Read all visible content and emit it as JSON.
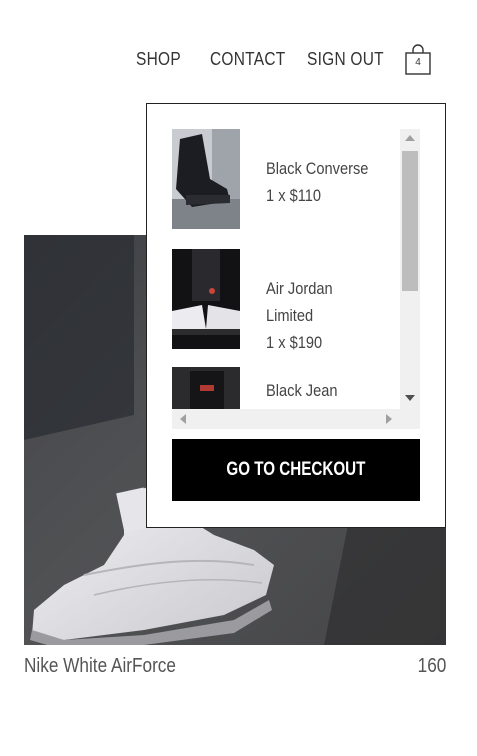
{
  "nav": {
    "items": [
      {
        "label": "SHOP"
      },
      {
        "label": "CONTACT"
      },
      {
        "label": "SIGN OUT"
      }
    ],
    "cart_icon": "shopping-bag-icon",
    "cart_count": "4"
  },
  "product": {
    "name": "Nike White AirForce",
    "price": "160"
  },
  "cart": {
    "items": [
      {
        "name": "Black Converse",
        "qty_price": "1 x $110"
      },
      {
        "name": "Air Jordan",
        "name_line2": "Limited",
        "qty_price": "1 x $190"
      },
      {
        "name": "Black Jean",
        "qty_price": ""
      }
    ],
    "checkout_label": "GO TO CHECKOUT"
  },
  "colors": {
    "accent": "#000000",
    "background": "#ffffff",
    "text": "#333333"
  }
}
